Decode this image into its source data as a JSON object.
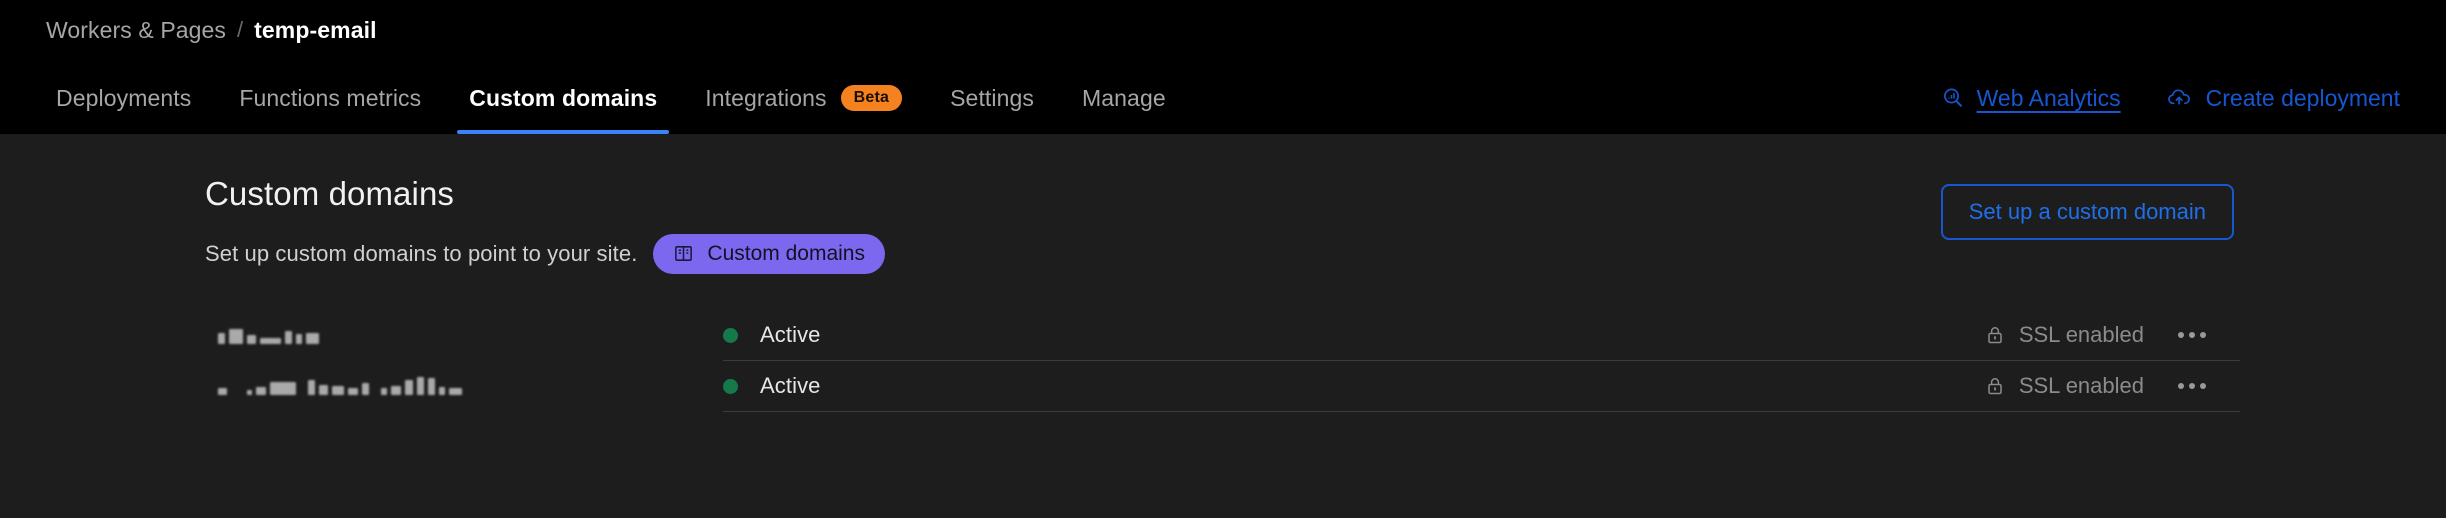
{
  "breadcrumb": {
    "parent": "Workers & Pages",
    "separator": "/",
    "current": "temp-email"
  },
  "tabs": [
    {
      "label": "Deployments",
      "active": false,
      "badge": null
    },
    {
      "label": "Functions metrics",
      "active": false,
      "badge": null
    },
    {
      "label": "Custom domains",
      "active": true,
      "badge": null
    },
    {
      "label": "Integrations",
      "active": false,
      "badge": "Beta"
    },
    {
      "label": "Settings",
      "active": false,
      "badge": null
    },
    {
      "label": "Manage",
      "active": false,
      "badge": null
    }
  ],
  "header_actions": [
    {
      "label": "Web Analytics",
      "icon": "analytics-search-icon",
      "underline": true
    },
    {
      "label": "Create deployment",
      "icon": "cloud-upload-icon",
      "underline": false
    }
  ],
  "main": {
    "title": "Custom domains",
    "subtitle": "Set up custom domains to point to your site.",
    "docs_pill": {
      "label": "Custom domains",
      "icon": "book-icon"
    },
    "setup_button": "Set up a custom domain"
  },
  "table": {
    "rows": [
      {
        "domain": "",
        "domain_redacted": true,
        "status": "Active",
        "ssl": "SSL enabled",
        "menu": "•••"
      },
      {
        "domain": "",
        "domain_redacted": true,
        "status": "Active",
        "ssl": "SSL enabled",
        "menu": "•••"
      }
    ]
  },
  "colors": {
    "header_bg": "#000000",
    "content_bg": "#1d1d1d",
    "accent_blue": "#1f6feb",
    "tab_underline": "#3b82f6",
    "beta_orange": "#f6821f",
    "docs_purple": "#7b68ee",
    "status_green": "#16794a",
    "divider": "#3a3a42"
  }
}
